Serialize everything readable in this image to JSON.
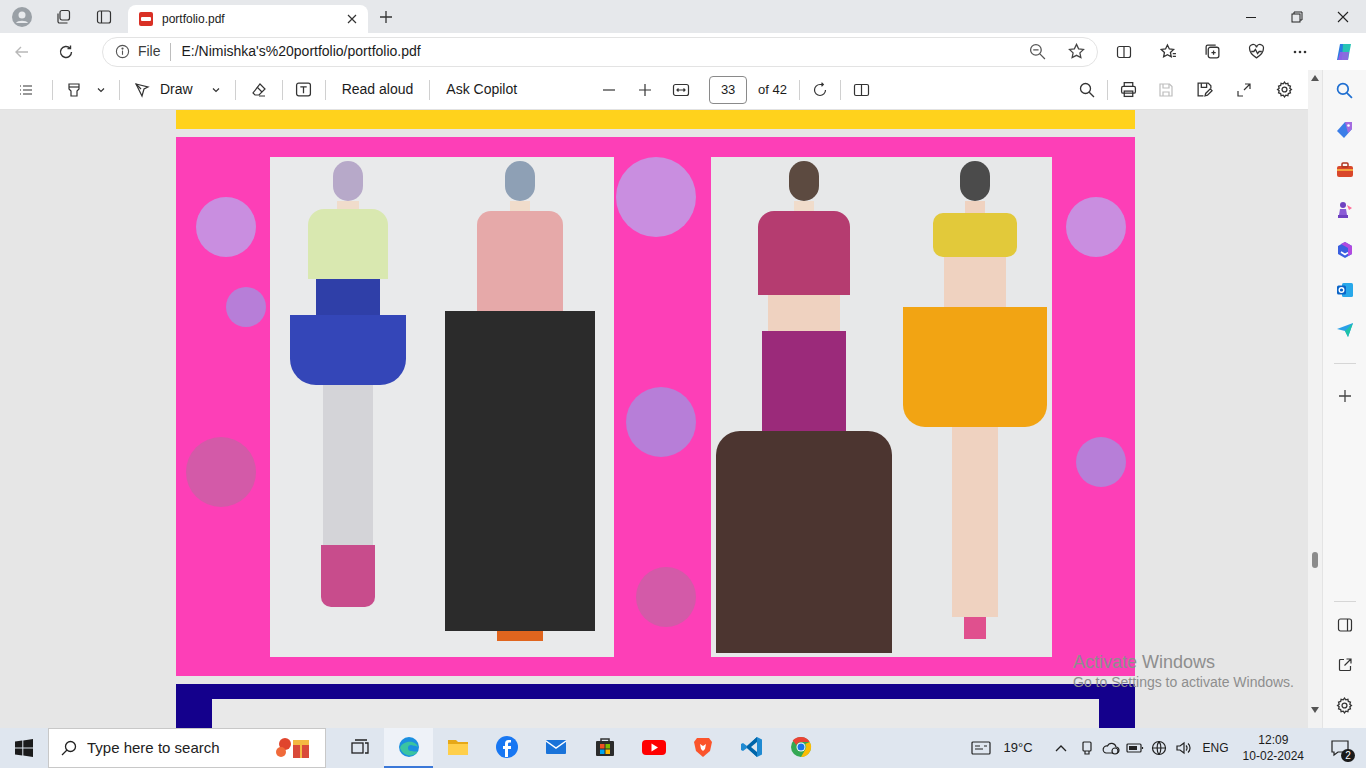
{
  "tabs": [
    {
      "label": "portfolio.pdf",
      "selected": true
    }
  ],
  "address_bar": {
    "scheme": "File",
    "url": "E:/Nimishka's%20portfolio/portfolio.pdf"
  },
  "pdf_toolbar": {
    "draw": "Draw",
    "read_aloud": "Read aloud",
    "ask_copilot": "Ask Copilot",
    "page": "33",
    "page_count": "of 42"
  },
  "scrollbar": {
    "level": 0.77
  },
  "watermark": {
    "title": "Activate Windows",
    "subtitle": "Go to Settings to activate Windows."
  },
  "taskbar": {
    "search_placeholder": "Type here to search",
    "apps": [
      {
        "running": true
      },
      {
        "running": false
      },
      {
        "running": false
      },
      {
        "running": false
      },
      {
        "running": false
      },
      {
        "running": false
      },
      {
        "running": false
      },
      {
        "running": false
      },
      {
        "running": false
      }
    ],
    "weather": "19°C",
    "language": "ENG",
    "time": "12:09",
    "date": "10-02-2024",
    "notifications": "2"
  }
}
